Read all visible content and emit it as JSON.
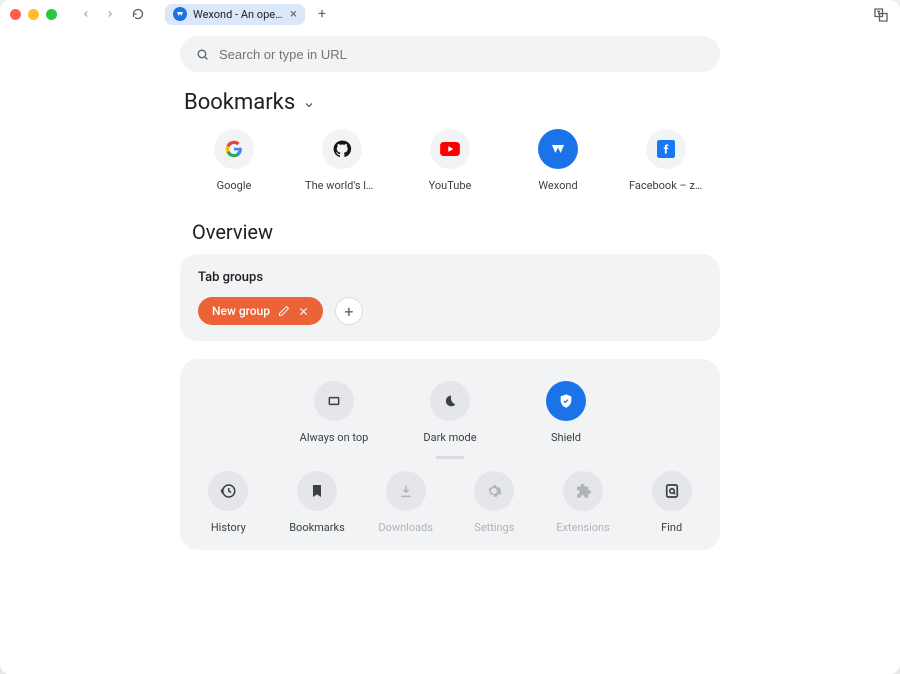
{
  "window": {
    "tab_title": "Wexond - An open-…"
  },
  "search": {
    "placeholder": "Search or type in URL"
  },
  "sections": {
    "bookmarks_title": "Bookmarks",
    "overview_title": "Overview",
    "tabgroups_title": "Tab groups"
  },
  "bookmarks": [
    {
      "label": "Google",
      "icon": "google"
    },
    {
      "label": "The world's lead…",
      "icon": "github"
    },
    {
      "label": "YouTube",
      "icon": "youtube"
    },
    {
      "label": "Wexond",
      "icon": "wexond"
    },
    {
      "label": "Facebook – zal…",
      "icon": "facebook"
    }
  ],
  "tabgroups": {
    "pill_label": "New group",
    "pill_color": "#ec6337"
  },
  "quick_actions": [
    {
      "label": "Always on top",
      "name": "always-on-top",
      "active": false
    },
    {
      "label": "Dark mode",
      "name": "dark-mode",
      "active": false
    },
    {
      "label": "Shield",
      "name": "shield",
      "active": true
    }
  ],
  "tools": [
    {
      "label": "History",
      "name": "history",
      "enabled": true
    },
    {
      "label": "Bookmarks",
      "name": "bookmarks-tool",
      "enabled": true
    },
    {
      "label": "Downloads",
      "name": "downloads",
      "enabled": false
    },
    {
      "label": "Settings",
      "name": "settings",
      "enabled": false
    },
    {
      "label": "Extensions",
      "name": "extensions",
      "enabled": false
    },
    {
      "label": "Find",
      "name": "find",
      "enabled": true
    }
  ]
}
